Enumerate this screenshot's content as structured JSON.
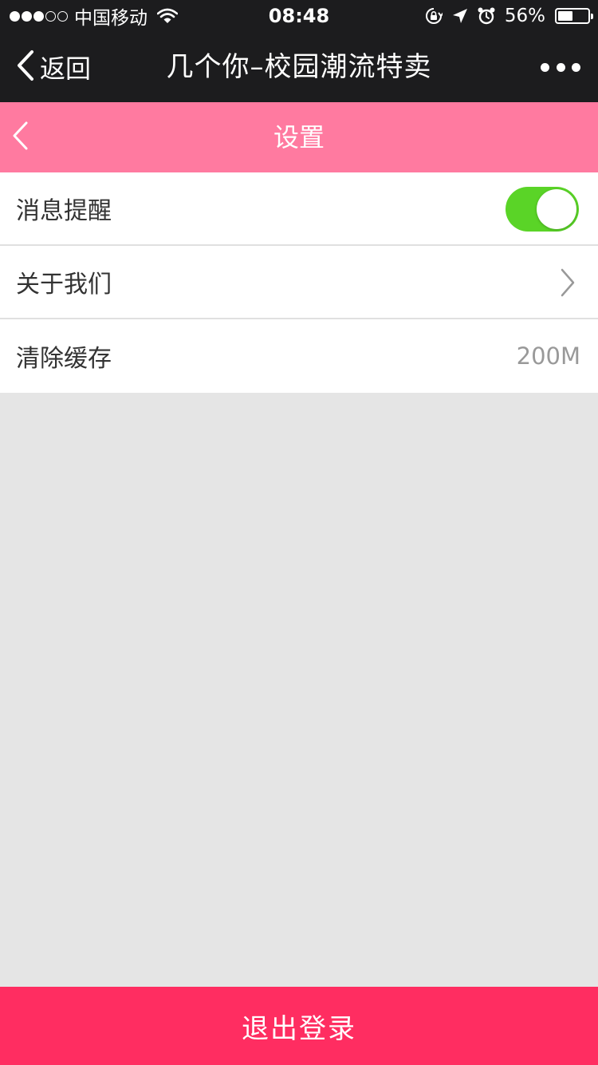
{
  "status_bar": {
    "carrier": "中国移动",
    "time": "08:48",
    "battery_percent": "56%",
    "battery_level": 0.56,
    "signal_filled": 3,
    "signal_total": 5,
    "icons": [
      "wifi-icon",
      "orientation-lock-icon",
      "location-icon",
      "alarm-icon",
      "battery-icon"
    ]
  },
  "wechat_header": {
    "back_label": "返回",
    "title": "几个你–校园潮流特卖",
    "more_icon": "more-dots-icon"
  },
  "page_header": {
    "title": "设置",
    "back_icon": "chevron-left-icon"
  },
  "settings": {
    "notifications": {
      "label": "消息提醒",
      "enabled": true
    },
    "about": {
      "label": "关于我们"
    },
    "cache": {
      "label": "清除缓存",
      "value": "200M"
    }
  },
  "logout": {
    "label": "退出登录"
  },
  "colors": {
    "status_bar_bg": "#1c1c1e",
    "page_header_bg": "#ff7aa0",
    "toggle_on": "#5ad427",
    "logout_bg": "#ff2d61",
    "page_bg": "#e5e5e5"
  }
}
